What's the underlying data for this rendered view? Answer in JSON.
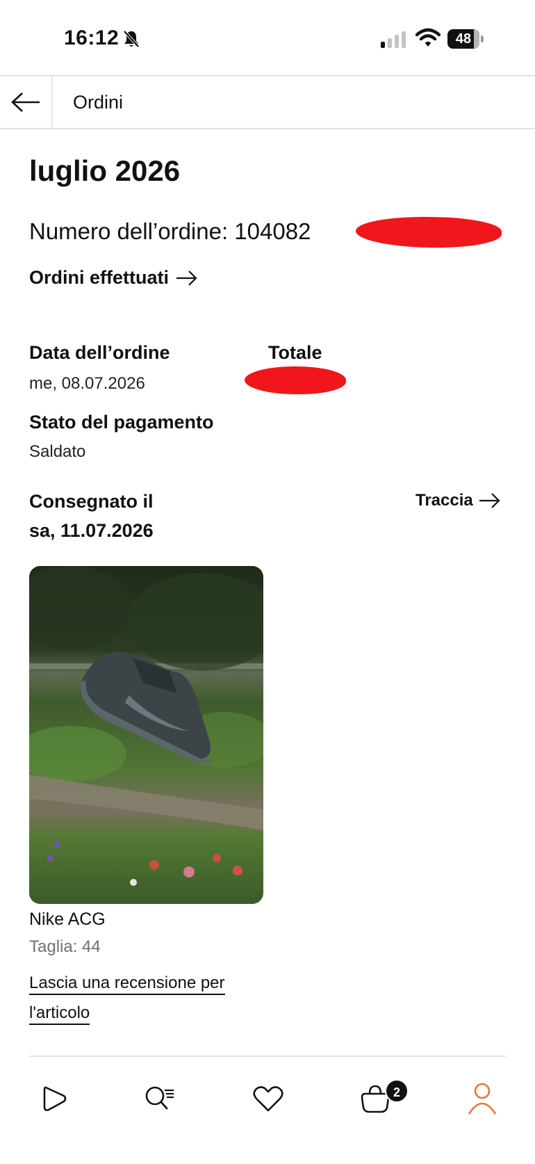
{
  "status_bar": {
    "time": "16:12",
    "battery": "48"
  },
  "header": {
    "title": "Ordini"
  },
  "order": {
    "month": "luglio 2026",
    "order_number_label": "Numero dell’ordine: 104082",
    "orders_link": "Ordini effettuati",
    "order_date_label": "Data dell’ordine",
    "order_date_value": "me, 08.07.2026",
    "total_label": "Totale",
    "payment_label": "Stato del pagamento",
    "payment_value": "Saldato",
    "delivered_label": "Consegnato il",
    "delivered_date": "sa, 11.07.2026",
    "track_link": "Traccia"
  },
  "product": {
    "name": "Nike ACG",
    "size": "Taglia: 44",
    "review_link": "Lascia una recensione per l'articolo"
  },
  "tab_bar": {
    "bag_badge_count": "2",
    "active_tab": "profile",
    "active_color": "#e2773a"
  }
}
